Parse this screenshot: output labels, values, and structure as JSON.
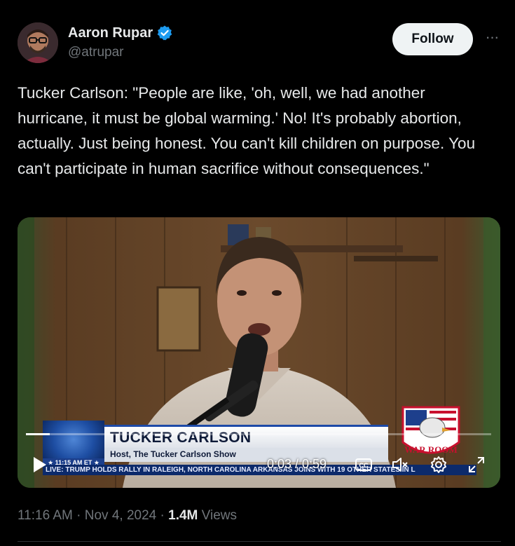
{
  "author": {
    "display_name": "Aaron Rupar",
    "handle": "@atrupar",
    "avatar_icon": "profile-photo",
    "verified_icon": "verified-badge-icon",
    "verified_color": "#1d9bf0"
  },
  "actions": {
    "follow_label": "Follow",
    "more_icon": "more-dots-icon",
    "more_label": "···"
  },
  "tweet": {
    "text": "Tucker Carlson: \"People are like, 'oh, well, we had another hurricane, it must be global warming.' No! It's probably abortion, actually. Just being honest. You can't kill children on purpose. You can't participate in human sacrifice without consequences.\""
  },
  "video": {
    "lower_third": {
      "name": "TUCKER CARLSON",
      "title": "Host, The Tucker Carlson Show",
      "time": "★ 11:15 AM ET ★",
      "ticker": "LIVE: TRUMP HOLDS RALLY IN RALEIGH, NORTH CAROLINA     ARKANSAS JOINS WITH 19 OTHER STATES IN L",
      "logo_text": "WAR ROOM"
    },
    "player": {
      "current_time": "0:03",
      "duration": "0:59",
      "time_display": "0:03 / 0:59",
      "progress_fraction": 0.051,
      "play_icon": "play-icon",
      "captions_icon": "cc-icon",
      "mute_icon": "muted-speaker-icon",
      "settings_icon": "gear-icon",
      "fullscreen_icon": "fullscreen-icon"
    }
  },
  "footer": {
    "time": "11:16 AM",
    "sep1": " · ",
    "date": "Nov 4, 2024",
    "sep2": " · ",
    "views_count": "1.4M",
    "views_label": " Views"
  },
  "colors": {
    "background": "#000000",
    "text_primary": "#e7e9ea",
    "text_secondary": "#71767b",
    "follow_bg": "#eff3f4",
    "divider": "#2f3336"
  }
}
